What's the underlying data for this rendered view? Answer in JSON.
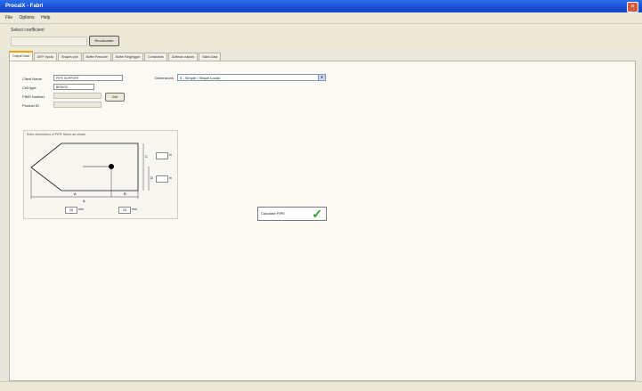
{
  "window": {
    "title": "ProcalX - Fabri",
    "close_glyph": "×"
  },
  "menu": [
    "File",
    "Options",
    "Help"
  ],
  "toolbar": {
    "label": "Select coefficient",
    "button": "Recalculate"
  },
  "tabs": [
    "Output Data",
    "DIFF Inputs",
    "Shapes plot",
    "Buffer Pressure",
    "Buffer Ringleggar",
    "Constraints",
    "Softmax outputs",
    "Sales Data"
  ],
  "active_tab": 0,
  "form": {
    "labels": [
      "Client Name",
      "Cell type",
      "PIMS Number",
      "Product ID"
    ],
    "values": [
      "PIPE SUPPORT",
      "BRIDGE",
      "",
      ""
    ],
    "get_button": "Get",
    "dimension_label": "Dimensions",
    "dimension_value": "5 - Simple / Shape Loads"
  },
  "diagram": {
    "title": "Enter dimensions of PIPE fixture as shown",
    "a_value": "25",
    "b_value": "25",
    "unit": "mm",
    "c_value": "",
    "d_value": "",
    "c_unit": "m",
    "d_unit": "m",
    "dim_labels": [
      "A",
      "B",
      "C",
      "D",
      "A"
    ]
  },
  "calculate_button": "Calculate PIPE",
  "check_glyph": "✓"
}
